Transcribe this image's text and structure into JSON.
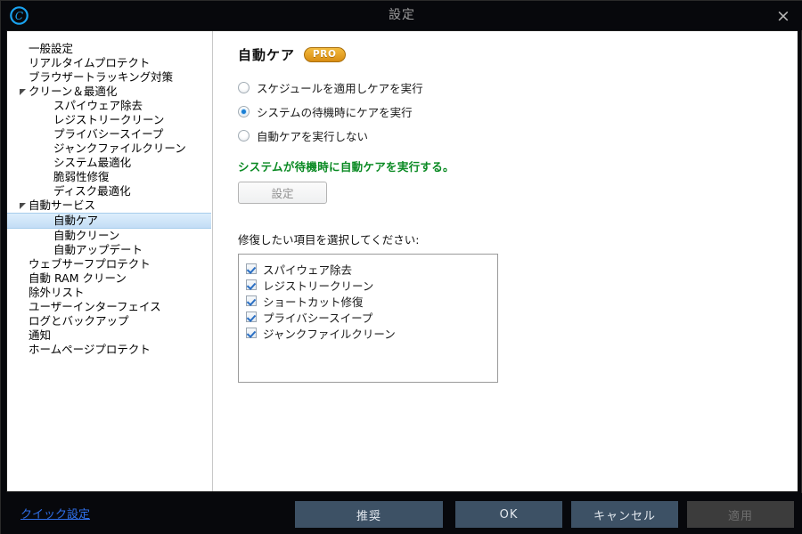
{
  "window": {
    "title": "設定",
    "logo_icon": "copyright-c-logo-icon",
    "close_icon": "×"
  },
  "sidebar": {
    "items": [
      {
        "label": "一般設定",
        "level": 0,
        "arrow": false,
        "selected": false
      },
      {
        "label": "リアルタイムプロテクト",
        "level": 0,
        "arrow": false,
        "selected": false
      },
      {
        "label": "ブラウザートラッキング対策",
        "level": 0,
        "arrow": false,
        "selected": false
      },
      {
        "label": "クリーン＆最適化",
        "level": 0,
        "arrow": true,
        "selected": false
      },
      {
        "label": "スパイウェア除去",
        "level": 1,
        "arrow": false,
        "selected": false
      },
      {
        "label": "レジストリークリーン",
        "level": 1,
        "arrow": false,
        "selected": false
      },
      {
        "label": "プライバシースイープ",
        "level": 1,
        "arrow": false,
        "selected": false
      },
      {
        "label": "ジャンクファイルクリーン",
        "level": 1,
        "arrow": false,
        "selected": false
      },
      {
        "label": "システム最適化",
        "level": 1,
        "arrow": false,
        "selected": false
      },
      {
        "label": "脆弱性修復",
        "level": 1,
        "arrow": false,
        "selected": false
      },
      {
        "label": "ディスク最適化",
        "level": 1,
        "arrow": false,
        "selected": false
      },
      {
        "label": "自動サービス",
        "level": 0,
        "arrow": true,
        "selected": false
      },
      {
        "label": "自動ケア",
        "level": 1,
        "arrow": false,
        "selected": true
      },
      {
        "label": "自動クリーン",
        "level": 1,
        "arrow": false,
        "selected": false
      },
      {
        "label": "自動アップデート",
        "level": 1,
        "arrow": false,
        "selected": false
      },
      {
        "label": "ウェブサーフプロテクト",
        "level": 0,
        "arrow": false,
        "selected": false
      },
      {
        "label": "自動 RAM クリーン",
        "level": 0,
        "arrow": false,
        "selected": false
      },
      {
        "label": "除外リスト",
        "level": 0,
        "arrow": false,
        "selected": false
      },
      {
        "label": "ユーザーインターフェイス",
        "level": 0,
        "arrow": false,
        "selected": false
      },
      {
        "label": "ログとバックアップ",
        "level": 0,
        "arrow": false,
        "selected": false
      },
      {
        "label": "通知",
        "level": 0,
        "arrow": false,
        "selected": false
      },
      {
        "label": "ホームページプロテクト",
        "level": 0,
        "arrow": false,
        "selected": false
      }
    ]
  },
  "content": {
    "heading": "自動ケア",
    "pro_badge": "PRO",
    "radios": [
      {
        "label": "スケジュールを適用しケアを実行",
        "checked": false
      },
      {
        "label": "システムの待機時にケアを実行",
        "checked": true
      },
      {
        "label": "自動ケアを実行しない",
        "checked": false
      }
    ],
    "status_note": "システムが待機時に自動ケアを実行する。",
    "status_color": "#0a8a23",
    "settings_button": "設定",
    "list_label": "修復したい項目を選択してください:",
    "checkitems": [
      {
        "label": "スパイウェア除去",
        "checked": true
      },
      {
        "label": "レジストリークリーン",
        "checked": true
      },
      {
        "label": "ショートカット修復",
        "checked": true
      },
      {
        "label": "プライバシースイープ",
        "checked": true
      },
      {
        "label": "ジャンクファイルクリーン",
        "checked": true
      }
    ]
  },
  "footer": {
    "quick_link": "クイック設定",
    "buttons": [
      {
        "id": "btn-recommend",
        "label": "推奨",
        "disabled": false
      },
      {
        "id": "btn-ok",
        "label": "OK",
        "disabled": false
      },
      {
        "id": "btn-cancel",
        "label": "キャンセル",
        "disabled": false
      },
      {
        "id": "btn-apply",
        "label": "適用",
        "disabled": true
      }
    ]
  },
  "colors": {
    "chrome": "#07080c",
    "button": "#3d5165",
    "button_disabled": "#3c3c3c",
    "link": "#2f6fe8",
    "selection": "#c3ddf5",
    "accent_gold": "#d98d12"
  }
}
